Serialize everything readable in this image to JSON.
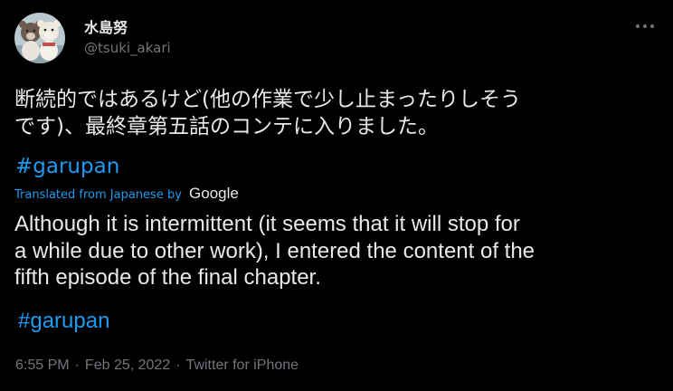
{
  "author": {
    "display_name": "水島努",
    "handle": "@tsuki_akari"
  },
  "original_text": {
    "line1": "断続的ではあるけど(他の作業で少し止まったりしそう",
    "line2": "です)、最終章第五話のコンテに入りました。",
    "hashtag": "#garupan"
  },
  "translation_label": {
    "prefix": "Translated from Japanese by",
    "provider": "Google"
  },
  "translated_text": {
    "line1": "Although it is intermittent (it seems that it will stop for",
    "line2": "a while due to other work), I entered the content of the",
    "line3": "fifth episode of the final chapter.",
    "hashtag": "#garupan"
  },
  "meta": {
    "time": "6:55 PM",
    "separator1": "·",
    "date": "Feb 25, 2022",
    "separator2": "·",
    "source": "Twitter for iPhone"
  },
  "icons": {
    "more": "more-options-icon",
    "avatar": "avatar-image"
  },
  "colors": {
    "background": "#000000",
    "text": "#e7e9ea",
    "secondary": "#71767b",
    "accent": "#1d9bf0"
  }
}
